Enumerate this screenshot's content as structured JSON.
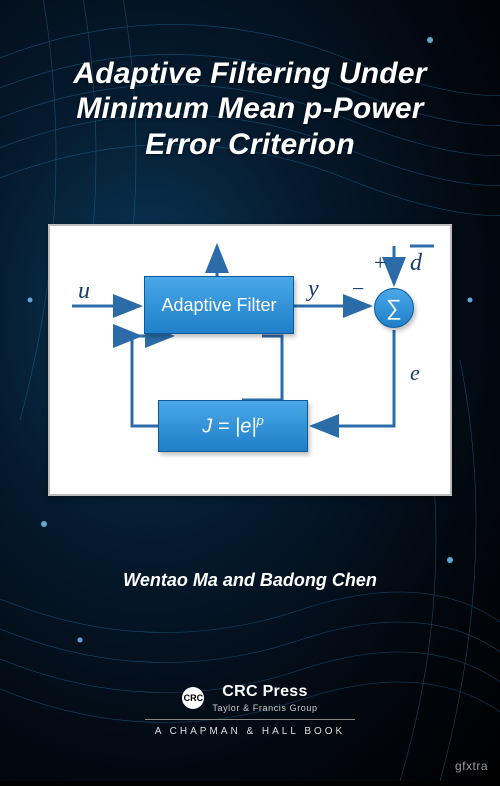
{
  "title_line1": "Adaptive Filtering Under",
  "title_line2": "Minimum Mean p-Power",
  "title_line3": "Error Criterion",
  "diagram": {
    "input_label": "u",
    "filter_label": "Adaptive Filter",
    "output_label": "y",
    "minus_label": "−",
    "plus_label": "+",
    "desired_label": "d",
    "sum_symbol": "∑",
    "error_label": "e",
    "cost_label": "J = |e|",
    "cost_exponent": "p"
  },
  "authors": "Wentao Ma and Badong Chen",
  "publisher": {
    "crc": "CRC Press",
    "tf": "Taylor & Francis Group",
    "chapman": "A CHAPMAN & HALL BOOK",
    "logo_text": "CRC"
  },
  "watermark": "gfxtra"
}
